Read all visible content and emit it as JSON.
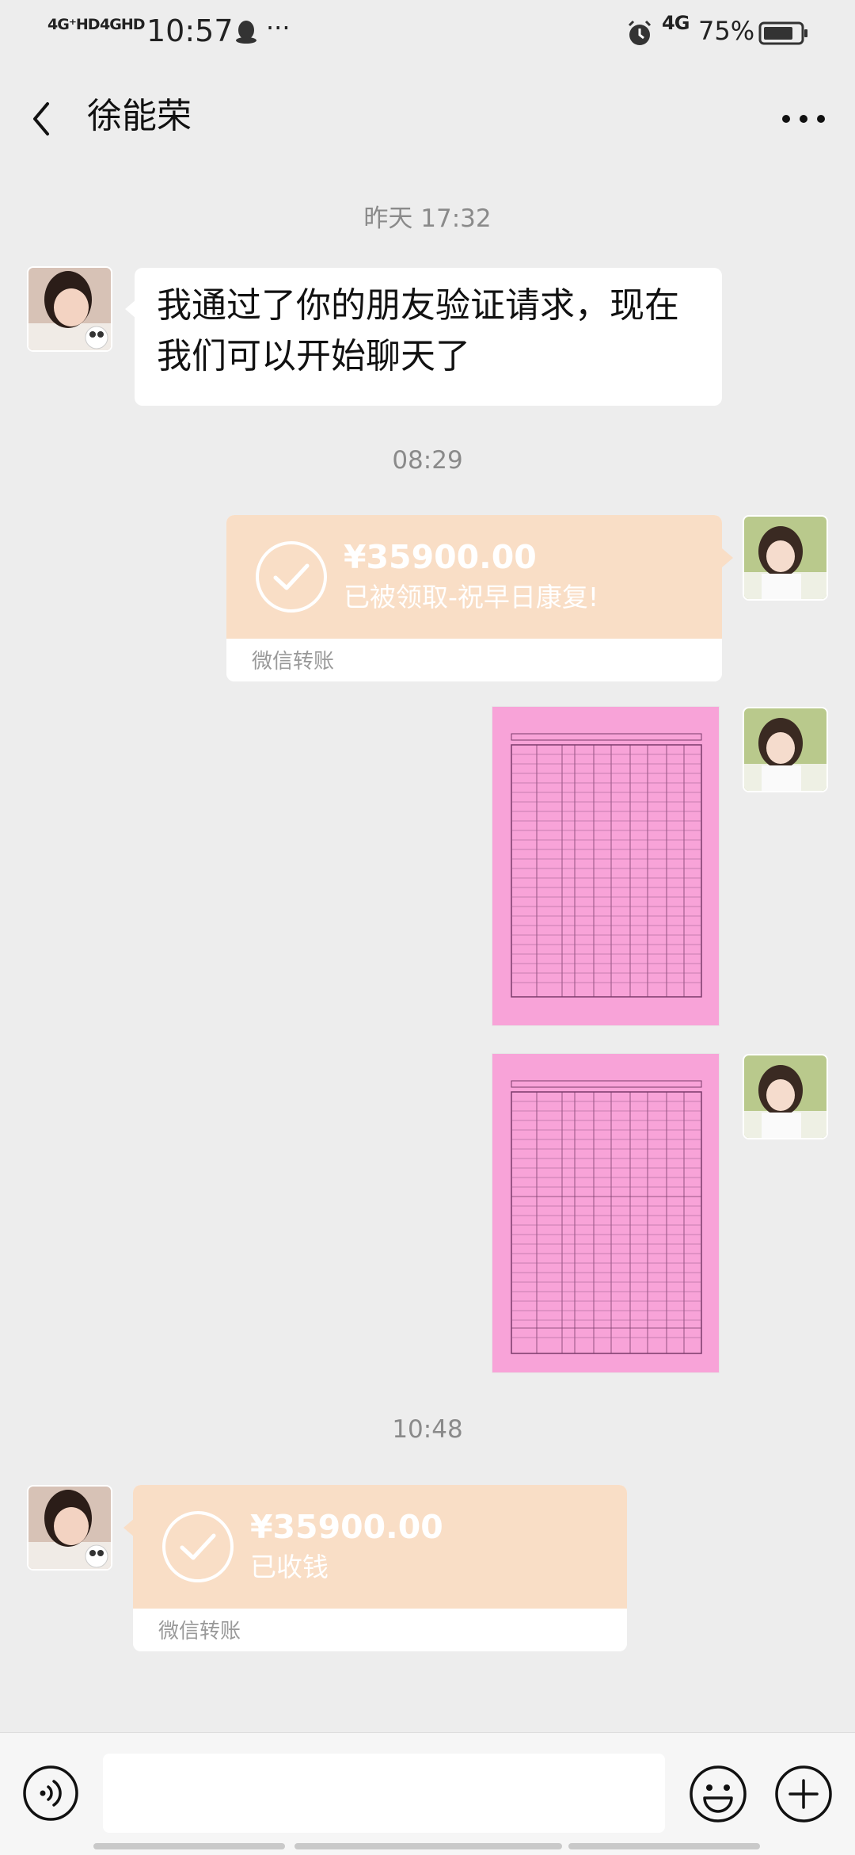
{
  "status_bar": {
    "signal1": "4G⁺HD",
    "signal2": "4GHD",
    "time": "10:57",
    "more": "···",
    "network": "4G",
    "battery": "75%"
  },
  "header": {
    "title": "徐能荣"
  },
  "messages": {
    "ts1": "昨天 17:32",
    "friend_text": "我通过了你的朋友验证请求，现在我们可以开始聊天了",
    "ts2": "08:29",
    "transfer1": {
      "amount": "¥35900.00",
      "note": "已被领取-祝早日康复!",
      "label": "微信转账"
    },
    "ts3": "10:48",
    "transfer2": {
      "amount": "¥35900.00",
      "note": "已收钱",
      "label": "微信转账"
    }
  },
  "colors": {
    "transfer_bg": "#f9dec6",
    "image_pink": "#f8a3d8",
    "chat_bg": "#ededed"
  },
  "icons": [
    "back-icon",
    "more-icon",
    "voice-icon",
    "emoji-icon",
    "plus-icon",
    "check-icon"
  ]
}
